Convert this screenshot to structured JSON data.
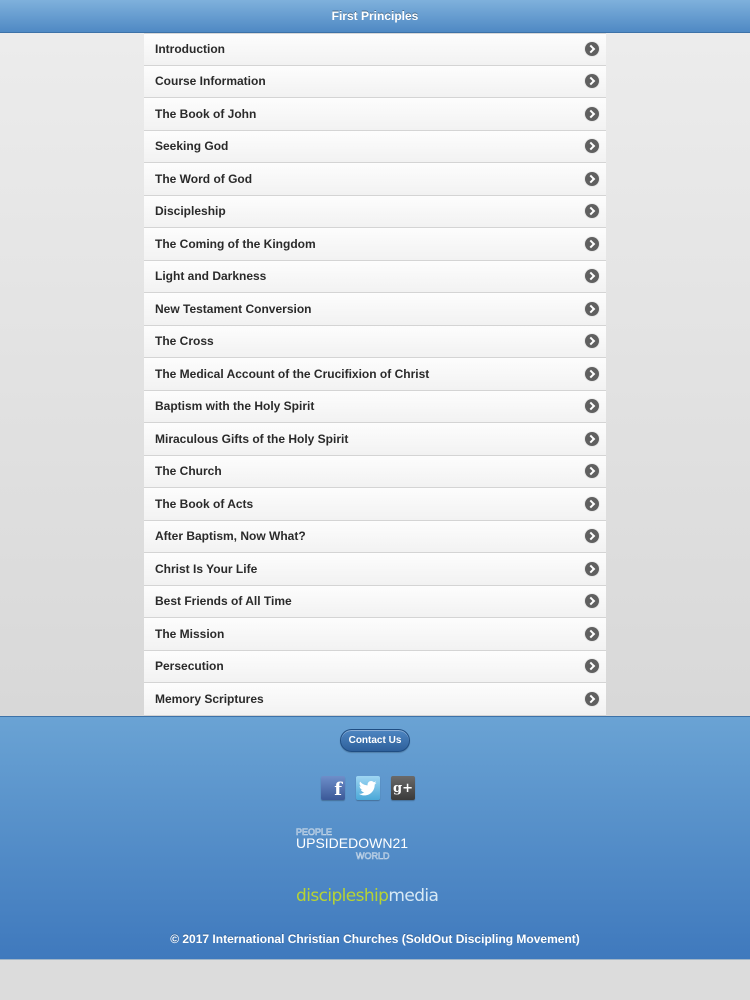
{
  "header": {
    "title": "First Principles"
  },
  "lessons": [
    {
      "label": "Introduction"
    },
    {
      "label": "Course Information"
    },
    {
      "label": "The Book of John"
    },
    {
      "label": "Seeking God"
    },
    {
      "label": "The Word of God"
    },
    {
      "label": "Discipleship"
    },
    {
      "label": "The Coming of the Kingdom"
    },
    {
      "label": "Light and Darkness"
    },
    {
      "label": "New Testament Conversion"
    },
    {
      "label": "The Cross"
    },
    {
      "label": "The Medical Account of the Crucifixion of Christ"
    },
    {
      "label": "Baptism with the Holy Spirit"
    },
    {
      "label": "Miraculous Gifts of the Holy Spirit"
    },
    {
      "label": "The Church"
    },
    {
      "label": "The Book of Acts"
    },
    {
      "label": "After Baptism, Now What?"
    },
    {
      "label": "Christ Is Your Life"
    },
    {
      "label": "Best Friends of All Time"
    },
    {
      "label": "The Mission"
    },
    {
      "label": "Persecution"
    },
    {
      "label": "Memory Scriptures"
    }
  ],
  "footer": {
    "contact_label": "Contact Us",
    "social": [
      {
        "icon": "facebook-icon",
        "glyph": "f"
      },
      {
        "icon": "twitter-icon",
        "glyph": "🐦"
      },
      {
        "icon": "google-plus-icon",
        "glyph": "g+"
      }
    ],
    "upsidedown_logo": {
      "main": "UPSIDEDOWN21",
      "above": "PEOPLE",
      "below": "WORLD"
    },
    "discipleship_logo": {
      "part1": "discipleship",
      "part2": "media"
    },
    "copyright": "© 2017 International Christian Churches (SoldOut Discipling Movement)"
  }
}
